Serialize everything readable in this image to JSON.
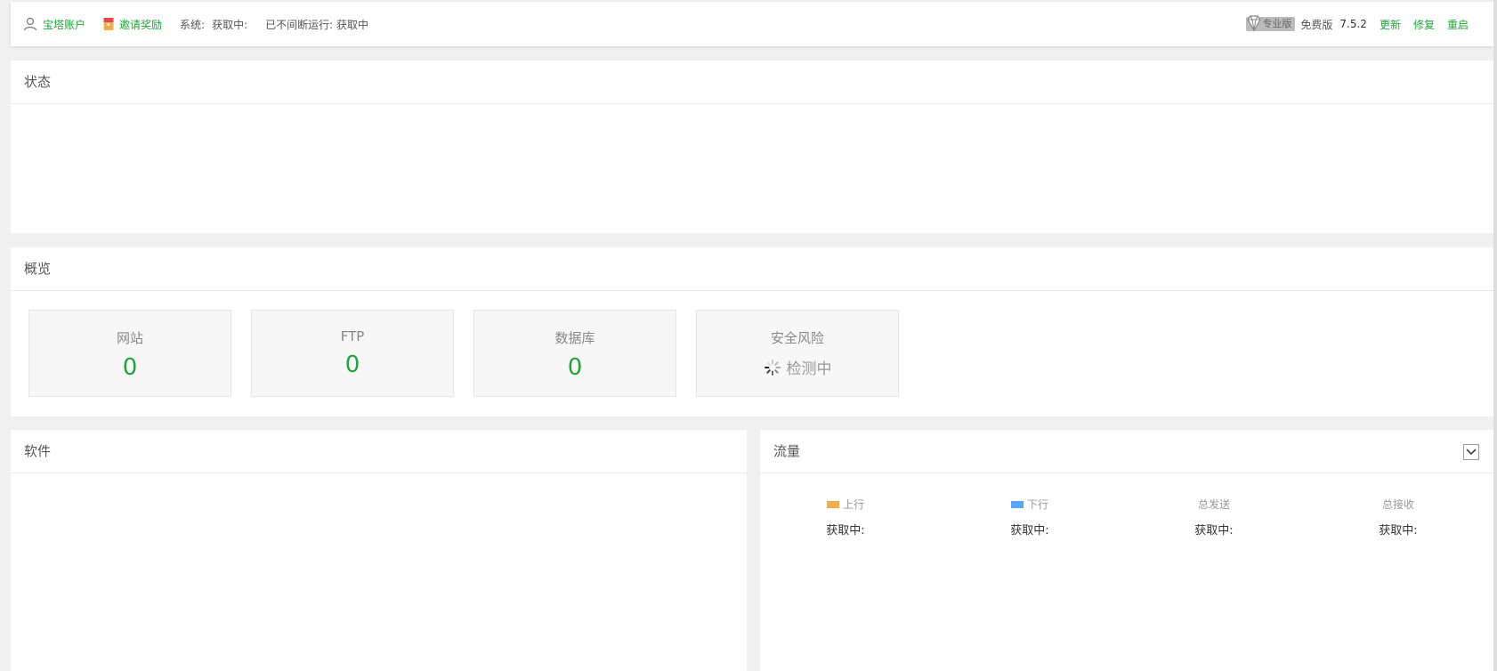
{
  "topbar": {
    "account": "宝塔账户",
    "invite": "邀请奖励",
    "system_label": "系统:",
    "system_value": "获取中:",
    "uptime": "已不间断运行: 获取中",
    "pro_badge": "专业版",
    "edition": "免费版",
    "version": "7.5.2",
    "update": "更新",
    "repair": "修复",
    "restart": "重启"
  },
  "status": {
    "title": "状态"
  },
  "overview": {
    "title": "概览",
    "cards": [
      {
        "label": "网站",
        "value": "0"
      },
      {
        "label": "FTP",
        "value": "0"
      },
      {
        "label": "数据库",
        "value": "0"
      },
      {
        "label": "安全风险",
        "value": "检测中"
      }
    ]
  },
  "software": {
    "title": "软件"
  },
  "traffic": {
    "title": "流量",
    "columns": [
      {
        "label": "上行",
        "value": "获取中:",
        "color": "#f0ad4e"
      },
      {
        "label": "下行",
        "value": "获取中:",
        "color": "#52a9ff"
      },
      {
        "label": "总发送",
        "value": "获取中:"
      },
      {
        "label": "总接收",
        "value": "获取中:"
      }
    ]
  },
  "colors": {
    "accent": "#20a53a",
    "background": "#f0f0f0"
  }
}
